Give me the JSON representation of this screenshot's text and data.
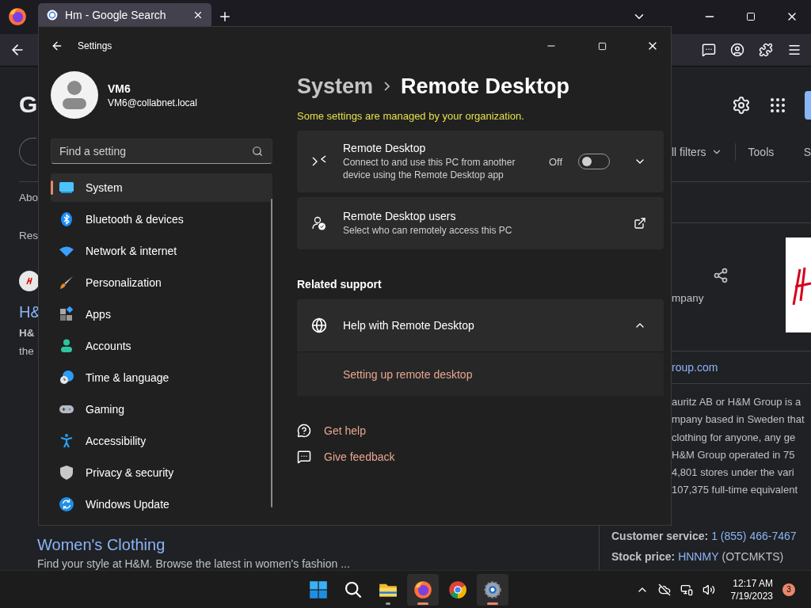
{
  "browser": {
    "tabs": [
      {
        "label": "Hm - Google Search",
        "selected": true
      }
    ]
  },
  "page": {
    "logo": "G",
    "about": "Abo",
    "results": "Res",
    "result_title": "H&",
    "result_brand": "H&",
    "result_snippet": "the",
    "filters": "ll filters",
    "tools": "Tools",
    "tab_cut": "S",
    "panel_subtitle": "mpany",
    "website": "roup.com",
    "description": [
      "auritz AB or H&M Group is a",
      "mpany based in Sweden that",
      "clothing for anyone, any ge",
      "H&M Group operated in 75",
      "4,801 stores under the vari",
      "107,375 full-time equivalent"
    ],
    "link_title": "Women's Clothing",
    "link_snippet": "Find your style at H&M. Browse the latest in women's fashion ...",
    "facts": [
      {
        "label": "Customer service:",
        "link": "1 (855) 466-7467"
      },
      {
        "label": "Stock price:",
        "link": "HNNMY",
        "note": "(OTCMKTS)"
      }
    ]
  },
  "settings": {
    "title": "Settings",
    "user": {
      "name": "VM6",
      "email": "VM6@collabnet.local"
    },
    "search": {
      "placeholder": "Find a setting"
    },
    "nav": [
      {
        "label": "System",
        "selected": true
      },
      {
        "label": "Bluetooth & devices",
        "selected": false
      },
      {
        "label": "Network & internet",
        "selected": false
      },
      {
        "label": "Personalization",
        "selected": false
      },
      {
        "label": "Apps",
        "selected": false
      },
      {
        "label": "Accounts",
        "selected": false
      },
      {
        "label": "Time & language",
        "selected": false
      },
      {
        "label": "Gaming",
        "selected": false
      },
      {
        "label": "Accessibility",
        "selected": false
      },
      {
        "label": "Privacy & security",
        "selected": false
      },
      {
        "label": "Windows Update",
        "selected": false
      }
    ],
    "breadcrumb": [
      "System",
      "Remote Desktop"
    ],
    "notice": "Some settings are managed by your organization.",
    "cards": [
      {
        "kind": "toggle",
        "title": "Remote Desktop",
        "description": "Connect to and use this PC from another device using the Remote Desktop app",
        "state": "Off",
        "on": false,
        "expanded": false
      },
      {
        "kind": "link",
        "title": "Remote Desktop users",
        "description": "Select who can remotely access this PC"
      }
    ],
    "related": {
      "heading": "Related support",
      "title": "Help with Remote Desktop",
      "expanded": true,
      "links": [
        "Setting up remote desktop"
      ]
    },
    "footer_links": [
      "Get help",
      "Give feedback"
    ]
  },
  "taskbar": {
    "apps": [
      {
        "running": false,
        "selected": false
      },
      {
        "running": false,
        "selected": false
      },
      {
        "running": true,
        "selected": false
      },
      {
        "running": true,
        "selected": true
      },
      {
        "running": false,
        "selected": false
      },
      {
        "running": true,
        "selected": true
      }
    ],
    "time": "12:17 AM",
    "date": "7/19/2023",
    "notifications": "3"
  }
}
